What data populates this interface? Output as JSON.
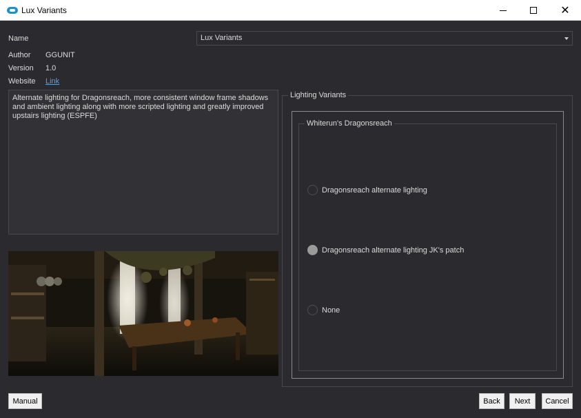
{
  "window": {
    "title": "Lux Variants",
    "minimize_icon": "minimize-icon",
    "maximize_icon": "maximize-icon",
    "close_icon": "close-icon"
  },
  "info": {
    "name_label": "Name",
    "name_value": "Lux Variants",
    "author_label": "Author",
    "author_value": "GGUNIT",
    "version_label": "Version",
    "version_value": "1.0",
    "website_label": "Website",
    "website_link": "Link",
    "description": "Alternate lighting for Dragonsreach, more consistent window frame shadows and ambient lighting along with more scripted lighting and greatly improved upstairs lighting (ESPFE)"
  },
  "variants": {
    "group_title": "Lighting Variants",
    "subgroup_title": "Whiterun's Dragonsreach",
    "options": [
      {
        "label": "Dragonsreach alternate lighting",
        "checked": false
      },
      {
        "label": "Dragonsreach alternate lighting JK's patch",
        "checked": true
      },
      {
        "label": "None",
        "checked": false
      }
    ]
  },
  "buttons": {
    "manual": "Manual",
    "back": "Back",
    "next": "Next",
    "cancel": "Cancel"
  },
  "colors": {
    "background": "#2b2b2f",
    "link": "#4aa3ff",
    "accent_icon": "#1e90c8"
  }
}
